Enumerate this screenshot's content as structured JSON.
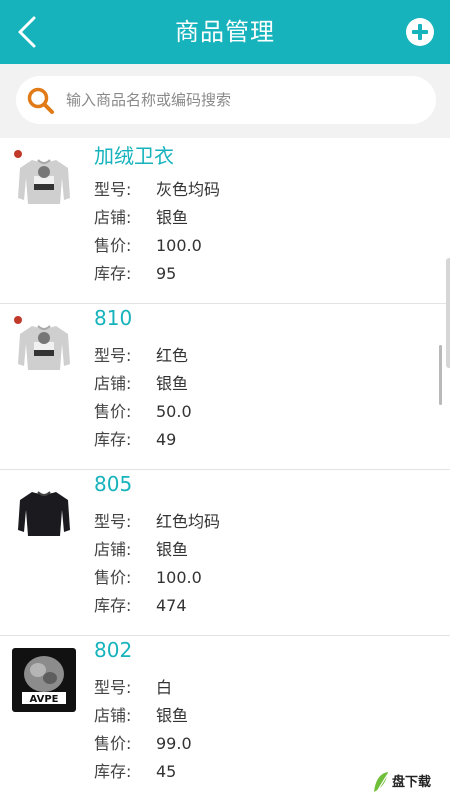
{
  "header": {
    "title": "商品管理",
    "back_icon": "chevron-left-icon",
    "add_icon": "plus-circle-icon",
    "bg_color": "#16b3bd"
  },
  "search": {
    "placeholder": "输入商品名称或编码搜索",
    "icon": "search-icon",
    "icon_color": "#e07b17"
  },
  "labels": {
    "model": "型号:",
    "shop": "店铺:",
    "price": "售价:",
    "stock": "库存:"
  },
  "products": [
    {
      "name": "加绒卫衣",
      "model": "灰色均码",
      "shop": "银鱼",
      "price": "100.0",
      "stock": "95",
      "image": "gray-sweatshirt-image"
    },
    {
      "name": "810",
      "model": "红色",
      "shop": "银鱼",
      "price": "50.0",
      "stock": "49",
      "image": "gray-sweatshirt-image"
    },
    {
      "name": "805",
      "model": "红色均码",
      "shop": "银鱼",
      "price": "100.0",
      "stock": "474",
      "image": "black-sweatshirt-image"
    },
    {
      "name": "802",
      "model": "白",
      "shop": "银鱼",
      "price": "99.0",
      "stock": "45",
      "image": "ape-logo-image"
    }
  ],
  "watermark": {
    "main": "盘下载",
    "icon": "leaf-logo-icon"
  }
}
